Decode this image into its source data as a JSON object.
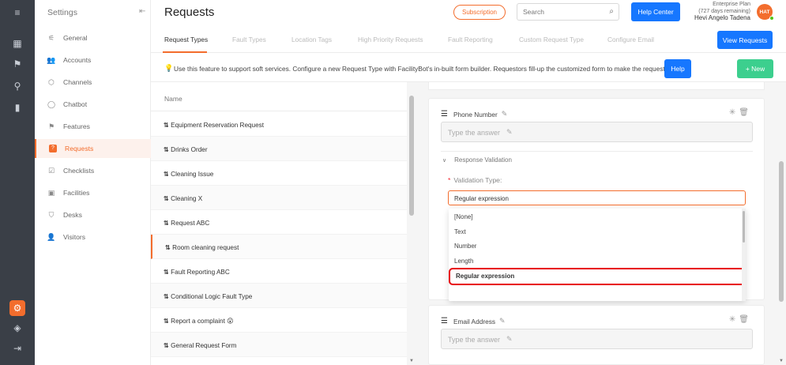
{
  "rail": {
    "icons": [
      "menu-toggle-icon",
      "dashboard-icon",
      "features-icon",
      "hierarchy-icon",
      "analytics-icon",
      "settings-icon",
      "cube-icon",
      "logout-icon"
    ]
  },
  "sidebar": {
    "title": "Settings",
    "items": [
      {
        "label": "General",
        "icon": "sliders-icon"
      },
      {
        "label": "Accounts",
        "icon": "users-icon"
      },
      {
        "label": "Channels",
        "icon": "cube-icon"
      },
      {
        "label": "Chatbot",
        "icon": "chat-icon"
      },
      {
        "label": "Features",
        "icon": "flag-icon"
      },
      {
        "label": "Requests",
        "icon": "request-icon"
      },
      {
        "label": "Checklists",
        "icon": "checklist-icon"
      },
      {
        "label": "Facilities",
        "icon": "building-icon"
      },
      {
        "label": "Desks",
        "icon": "desk-icon"
      },
      {
        "label": "Visitors",
        "icon": "visitor-icon"
      }
    ],
    "active_index": 5
  },
  "header": {
    "title": "Requests",
    "subscription": "Subscription",
    "search_placeholder": "Search",
    "help_center": "Help Center",
    "plan": "Enterprise Plan",
    "days_remaining": "(727 days remaining)",
    "user_name": "Hevi Angelo Tadena",
    "avatar_initials": "HAT"
  },
  "tabs": {
    "items": [
      "Request Types",
      "Fault Types",
      "Location Tags",
      "High Priority Requests",
      "Fault Reporting",
      "Custom Request Type",
      "Configure Email"
    ],
    "view_requests": "View Requests"
  },
  "info": {
    "text": "Use this feature to support soft services. Configure a new Request Type with FacilityBot's in-built form builder. Requestors fill-up the customized form to make the request.",
    "help": "Help",
    "new": "+ New"
  },
  "list": {
    "header": "Name",
    "rows": [
      "Equipment Reservation Request",
      "Drinks Order",
      "Cleaning Issue",
      "Cleaning X",
      "Request ABC",
      "Room cleaning request",
      "Fault Reporting ABC",
      "Conditional Logic Fault Type",
      "Report a complaint 😮",
      "General Request Form"
    ],
    "active_index": 5
  },
  "form": {
    "question1": {
      "title": "Phone Number",
      "answer_placeholder": "Type the answer",
      "response_validation": "Response Validation",
      "validation_type_label": "Validation Type:",
      "selected": "Regular expression",
      "options": [
        "[None]",
        "Text",
        "Number",
        "Length",
        "Regular expression"
      ]
    },
    "question2": {
      "title": "Email Address",
      "answer_placeholder": "Type the answer"
    }
  },
  "colors": {
    "accent": "#f36d2d",
    "primary": "#1677ff",
    "success": "#3ccf8e",
    "rail": "#3a3f47",
    "highlight": "#e8000a"
  }
}
